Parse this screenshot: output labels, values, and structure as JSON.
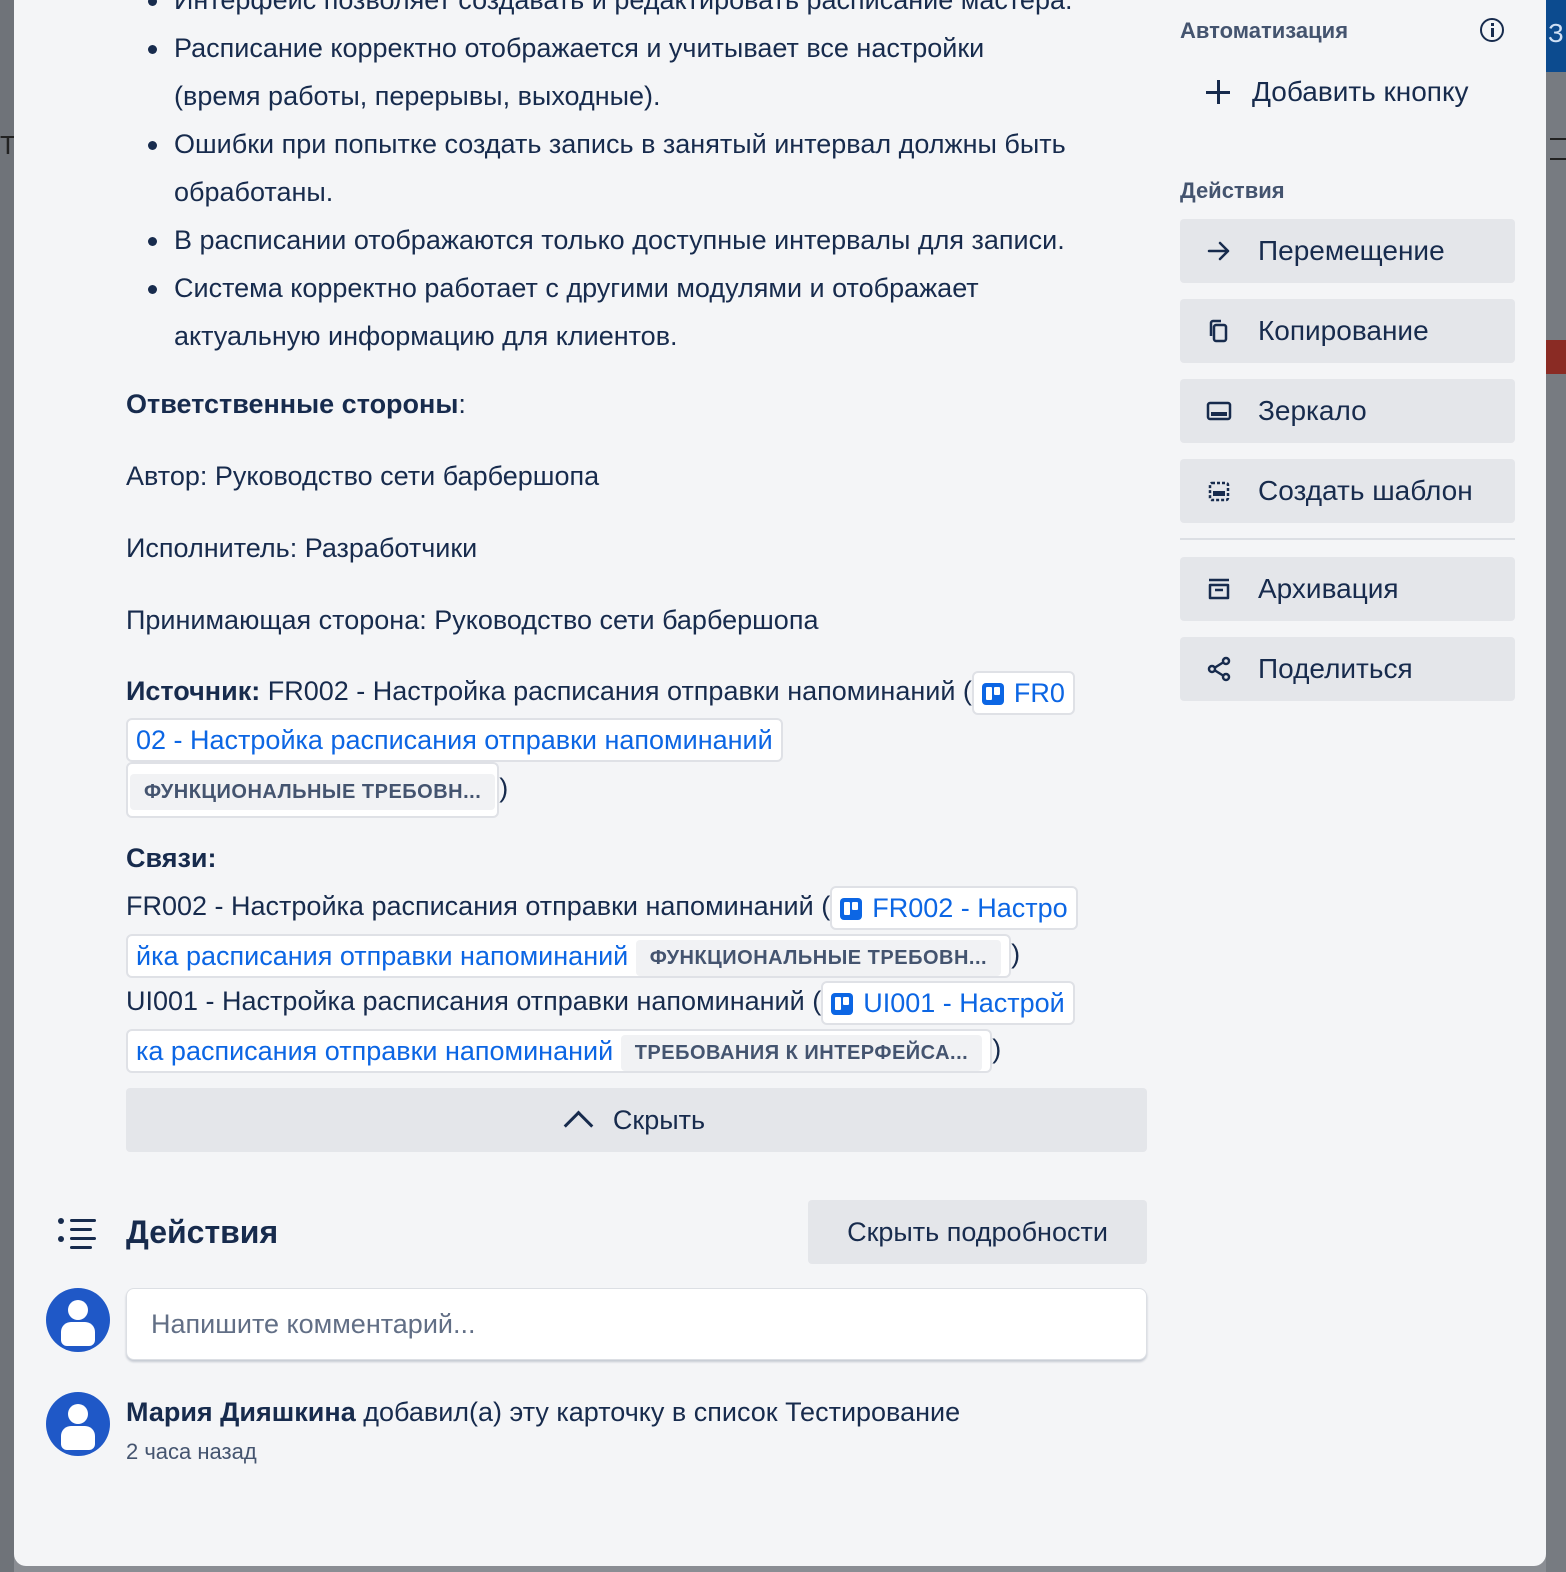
{
  "backdrop": {
    "left_fragment": "Ta",
    "right_fragment": "З"
  },
  "description": {
    "top_partial_line": "Интерфейс позволяет создавать и редактировать расписание мастера.",
    "bullets": [
      [
        "Расписание корректно отображается и учитывает все настройки",
        "(время работы, перерывы, выходные)."
      ],
      [
        "Ошибки при попытке создать запись в занятый интервал должны быть",
        "обработаны."
      ],
      [
        "В расписании отображаются только доступные интервалы для записи."
      ],
      [
        "Система корректно работает с другими модулями и отображает",
        "актуальную информацию для клиентов."
      ]
    ],
    "responsible_label": "Ответственные стороны",
    "responsible_colon": ":",
    "author": "Автор: Руководство сети барбершопа",
    "executor": "Исполнитель: Разработчики",
    "acceptor": "Принимающая сторона: Руководство сети барбершопа",
    "source_label": "Источник:",
    "source_text": " FR002 - Настройка расписания отправки напоминаний (",
    "source_link_part1": "FR0",
    "source_link_part2": "02 - Настройка расписания отправки напоминаний",
    "source_badge": "ФУНКЦИОНАЛЬНЫЕ ТРЕБОВН...",
    "close_paren": ")",
    "links_label": "Связи:",
    "link1_text": "FR002 - Настройка расписания отправки напоминаний (",
    "link1_part1": "FR002 - Настро",
    "link1_part2": "йка расписания отправки напоминаний",
    "link1_badge": "ФУНКЦИОНАЛЬНЫЕ ТРЕБОВН...",
    "link2_text": "UI001 - Настройка расписания отправки напоминаний (",
    "link2_part1": "UI001 - Настрой",
    "link2_part2": "ка расписания отправки напоминаний",
    "link2_badge": "ТРЕБОВАНИЯ К ИНТЕРФЕЙСА..."
  },
  "hide_button": "Скрыть",
  "activity": {
    "title": "Действия",
    "details_button": "Скрыть подробности",
    "comment_placeholder": "Напишите комментарий...",
    "entry_user": "Мария Дияшкина",
    "entry_text": " добавил(а) эту карточку в список Тестирование",
    "entry_time": "2 часа назад"
  },
  "sidebar": {
    "automation_label": "Автоматизация",
    "add_button": "Добавить кнопку",
    "actions_label": "Действия",
    "buttons": [
      {
        "label": "Перемещение",
        "icon": "arrow-right-icon"
      },
      {
        "label": "Копирование",
        "icon": "copy-icon"
      },
      {
        "label": "Зеркало",
        "icon": "mirror-icon"
      },
      {
        "label": "Создать шаблон",
        "icon": "template-icon"
      },
      {
        "label": "Архивация",
        "icon": "archive-icon"
      },
      {
        "label": "Поделиться",
        "icon": "share-icon"
      }
    ]
  },
  "colors": {
    "link": "#0c66e4",
    "button_bg": "#e4e6ea",
    "avatar": "#1f58c7",
    "text": "#172b4d"
  }
}
